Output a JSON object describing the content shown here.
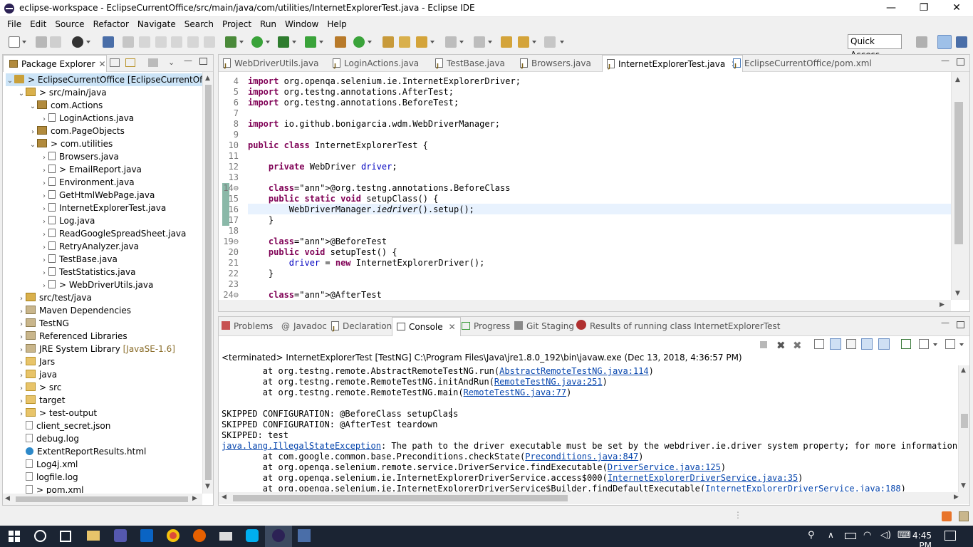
{
  "window": {
    "title": "eclipse-workspace - EclipseCurrentOffice/src/main/java/com/utilities/InternetExplorerTest.java - Eclipse IDE",
    "minimize": "—",
    "maximize": "❐",
    "close": "✕"
  },
  "menu": [
    "File",
    "Edit",
    "Source",
    "Refactor",
    "Navigate",
    "Search",
    "Project",
    "Run",
    "Window",
    "Help"
  ],
  "quick_access": "Quick Access",
  "package_explorer": {
    "tab_label": "Package Explorer",
    "items": [
      {
        "label": "> EclipseCurrentOffice [EclipseCurrentOffice",
        "icon": "project-icon"
      },
      {
        "label": "> src/main/java",
        "icon": "source-folder-icon"
      },
      {
        "label": "com.Actions",
        "icon": "package-icon"
      },
      {
        "label": "LoginActions.java",
        "icon": "java-file-icon"
      },
      {
        "label": "com.PageObjects",
        "icon": "package-icon"
      },
      {
        "label": "> com.utilities",
        "icon": "package-icon"
      },
      {
        "label": "Browsers.java",
        "icon": "java-file-icon"
      },
      {
        "label": "> EmailReport.java",
        "icon": "java-file-icon"
      },
      {
        "label": "Environment.java",
        "icon": "java-file-icon"
      },
      {
        "label": "GetHtmlWebPage.java",
        "icon": "java-file-icon"
      },
      {
        "label": "InternetExplorerTest.java",
        "icon": "java-file-icon"
      },
      {
        "label": "Log.java",
        "icon": "java-file-icon"
      },
      {
        "label": "ReadGoogleSpreadSheet.java",
        "icon": "java-file-icon"
      },
      {
        "label": "RetryAnalyzer.java",
        "icon": "java-file-icon"
      },
      {
        "label": "TestBase.java",
        "icon": "java-file-icon"
      },
      {
        "label": "TestStatistics.java",
        "icon": "java-file-icon"
      },
      {
        "label": "> WebDriverUtils.java",
        "icon": "java-file-icon"
      },
      {
        "label": "src/test/java",
        "icon": "source-folder-icon"
      },
      {
        "label": "Maven Dependencies",
        "icon": "library-icon"
      },
      {
        "label": "TestNG",
        "icon": "library-icon"
      },
      {
        "label": "Referenced Libraries",
        "icon": "library-icon"
      },
      {
        "label": "JRE System Library",
        "extra": "[JavaSE-1.6]",
        "icon": "library-icon"
      },
      {
        "label": "Jars",
        "icon": "folder-icon"
      },
      {
        "label": "java",
        "icon": "folder-icon"
      },
      {
        "label": "> src",
        "icon": "folder-icon"
      },
      {
        "label": "target",
        "icon": "folder-icon"
      },
      {
        "label": "> test-output",
        "icon": "folder-icon"
      },
      {
        "label": "client_secret.json",
        "icon": "file-icon"
      },
      {
        "label": "debug.log",
        "icon": "file-icon"
      },
      {
        "label": "ExtentReportResults.html",
        "icon": "html-file-icon"
      },
      {
        "label": "Log4j.xml",
        "icon": "file-icon"
      },
      {
        "label": "logfile.log",
        "icon": "file-icon"
      },
      {
        "label": "> pom.xml",
        "icon": "file-icon"
      }
    ]
  },
  "editor": {
    "tabs": [
      {
        "label": "WebDriverUtils.java",
        "active": false
      },
      {
        "label": "LoginActions.java",
        "active": false
      },
      {
        "label": "TestBase.java",
        "active": false
      },
      {
        "label": "Browsers.java",
        "active": false
      },
      {
        "label": "InternetExplorerTest.java",
        "active": true
      },
      {
        "label": "EclipseCurrentOffice/pom.xml",
        "active": false
      }
    ],
    "line_numbers": [
      "4",
      "5",
      "6",
      "7",
      "8",
      "9",
      "10",
      "11",
      "12",
      "13",
      "14⊖",
      "15",
      "16",
      "17",
      "18",
      "19⊖",
      "20",
      "21",
      "22",
      "23",
      "24⊖"
    ],
    "lines": [
      "import org.openqa.selenium.ie.InternetExplorerDriver;",
      "import org.testng.annotations.AfterTest;",
      "import org.testng.annotations.BeforeTest;",
      "",
      "import io.github.bonigarcia.wdm.WebDriverManager;",
      "",
      "public class InternetExplorerTest {",
      "",
      "    private WebDriver driver;",
      "",
      "    @org.testng.annotations.BeforeClass",
      "    public static void setupClass() {",
      "        WebDriverManager.iedriver().setup();",
      "    }",
      "",
      "    @BeforeTest",
      "    public void setupTest() {",
      "        driver = new InternetExplorerDriver();",
      "    }",
      "",
      "    @AfterTest"
    ]
  },
  "bottom_panel": {
    "tabs": [
      "Problems",
      "Javadoc",
      "Declaration",
      "Console",
      "Progress",
      "Git Staging",
      "Results of running class InternetExplorerTest"
    ],
    "header": "<terminated> InternetExplorerTest [TestNG] C:\\Program Files\\Java\\jre1.8.0_192\\bin\\javaw.exe (Dec 13, 2018, 4:36:57 PM)",
    "lines": [
      {
        "pre": "        at org.testng.remote.AbstractRemoteTestNG.run(",
        "link": "AbstractRemoteTestNG.java:114",
        "post": ")"
      },
      {
        "pre": "        at org.testng.remote.RemoteTestNG.initAndRun(",
        "link": "RemoteTestNG.java:251",
        "post": ")"
      },
      {
        "pre": "        at org.testng.remote.RemoteTestNG.main(",
        "link": "RemoteTestNG.java:77",
        "post": ")"
      },
      {
        "pre": "",
        "link": "",
        "post": ""
      },
      {
        "pre": "SKIPPED CONFIGURATION: @BeforeClass setupClass",
        "link": "",
        "post": ""
      },
      {
        "pre": "SKIPPED CONFIGURATION: @AfterTest teardown",
        "link": "",
        "post": ""
      },
      {
        "pre": "SKIPPED: test",
        "link": "",
        "post": ""
      },
      {
        "pre": "",
        "link": "java.lang.IllegalStateException",
        "post": ": The path to the driver executable must be set by the webdriver.ie.driver system property; for more information, see"
      },
      {
        "pre": "        at com.google.common.base.Preconditions.checkState(",
        "link": "Preconditions.java:847",
        "post": ")"
      },
      {
        "pre": "        at org.openqa.selenium.remote.service.DriverService.findExecutable(",
        "link": "DriverService.java:125",
        "post": ")"
      },
      {
        "pre": "        at org.openqa.selenium.ie.InternetExplorerDriverService.access$000(",
        "link": "InternetExplorerDriverService.java:35",
        "post": ")"
      },
      {
        "pre": "        at org.openqa.selenium.ie.InternetExplorerDriverService$Builder.findDefaultExecutable(",
        "link": "InternetExplorerDriverService.java:188",
        "post": ")"
      }
    ]
  },
  "taskbar": {
    "time": "4:45 PM"
  }
}
